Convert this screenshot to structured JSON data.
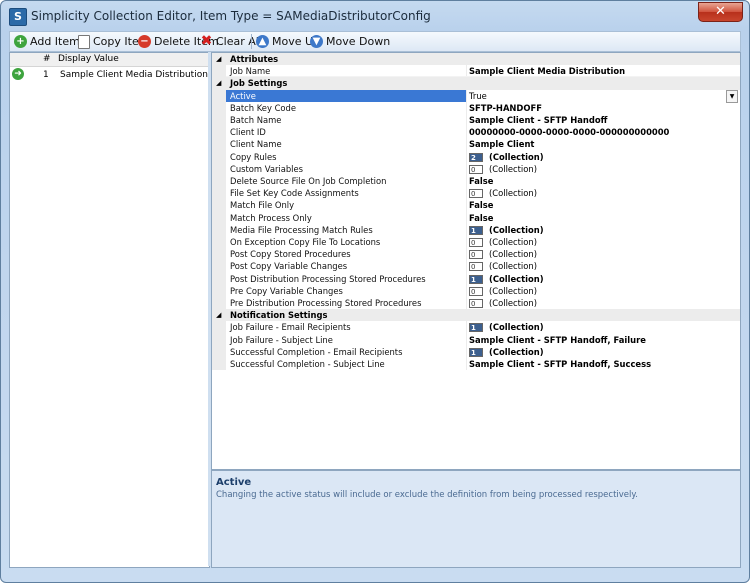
{
  "window": {
    "title": "Simplicity Collection Editor, Item Type = SAMediaDistributorConfig",
    "icon_letter": "S",
    "close_glyph": "✕"
  },
  "toolbar": {
    "add_label": "Add Item",
    "copy_label": "Copy Item",
    "delete_label": "Delete Item",
    "clear_label": "Clear All",
    "up_label": "Move Up",
    "down_label": "Move Down"
  },
  "list": {
    "col_num": "#",
    "col_value": "Display Value",
    "rows": [
      {
        "num": "1",
        "value": "Sample Client Media Distribution"
      }
    ]
  },
  "grid": {
    "categories": {
      "attributes": "Attributes",
      "job_settings": "Job Settings",
      "notification": "Notification Settings"
    },
    "rows": [
      {
        "name": "Job Name",
        "value": "Sample Client Media Distribution"
      },
      {
        "name": "Active",
        "value": "True"
      },
      {
        "name": "Batch Key Code",
        "value": "SFTP-HANDOFF"
      },
      {
        "name": "Batch Name",
        "value": "Sample Client - SFTP Handoff"
      },
      {
        "name": "Client ID",
        "value": "00000000-0000-0000-0000-000000000000"
      },
      {
        "name": "Client Name",
        "value": "Sample Client"
      },
      {
        "name": "Copy Rules",
        "value": "(Collection)",
        "count": "2"
      },
      {
        "name": "Custom Variables",
        "value": "(Collection)",
        "count": "0"
      },
      {
        "name": "Delete Source File On Job Completion",
        "value": "False"
      },
      {
        "name": "File Set Key Code Assignments",
        "value": "(Collection)",
        "count": "0"
      },
      {
        "name": "Match File Only",
        "value": "False"
      },
      {
        "name": "Match Process Only",
        "value": "False"
      },
      {
        "name": "Media File Processing Match Rules",
        "value": "(Collection)",
        "count": "1"
      },
      {
        "name": "On Exception Copy File To Locations",
        "value": "(Collection)",
        "count": "0"
      },
      {
        "name": "Post Copy Stored Procedures",
        "value": "(Collection)",
        "count": "0"
      },
      {
        "name": "Post Copy Variable Changes",
        "value": "(Collection)",
        "count": "0"
      },
      {
        "name": "Post Distribution Processing Stored Procedures",
        "value": "(Collection)",
        "count": "1"
      },
      {
        "name": "Pre Copy Variable Changes",
        "value": "(Collection)",
        "count": "0"
      },
      {
        "name": "Pre Distribution Processing Stored Procedures",
        "value": "(Collection)",
        "count": "0"
      },
      {
        "name": "Job Failure - Email Recipients",
        "value": "(Collection)",
        "count": "1"
      },
      {
        "name": "Job Failure - Subject Line",
        "value": "Sample Client - SFTP Handoff, Failure"
      },
      {
        "name": "Successful Completion - Email Recipients",
        "value": "(Collection)",
        "count": "1"
      },
      {
        "name": "Successful Completion - Subject Line",
        "value": "Sample Client - SFTP Handoff, Success"
      }
    ]
  },
  "help": {
    "title": "Active",
    "description": "Changing the active status will include or exclude the definition from being processed respectively."
  },
  "colors": {
    "selection": "#3a78d4",
    "collection_filled": "#3c5f8e",
    "window_frame": "#b9d1ec"
  },
  "icons": [
    "app-icon",
    "close-icon",
    "add-icon",
    "copy-icon",
    "delete-icon",
    "clear-icon",
    "move-up-icon",
    "move-down-icon",
    "current-row-arrow-icon",
    "collapse-triangle-icon",
    "dropdown-arrow-icon"
  ]
}
